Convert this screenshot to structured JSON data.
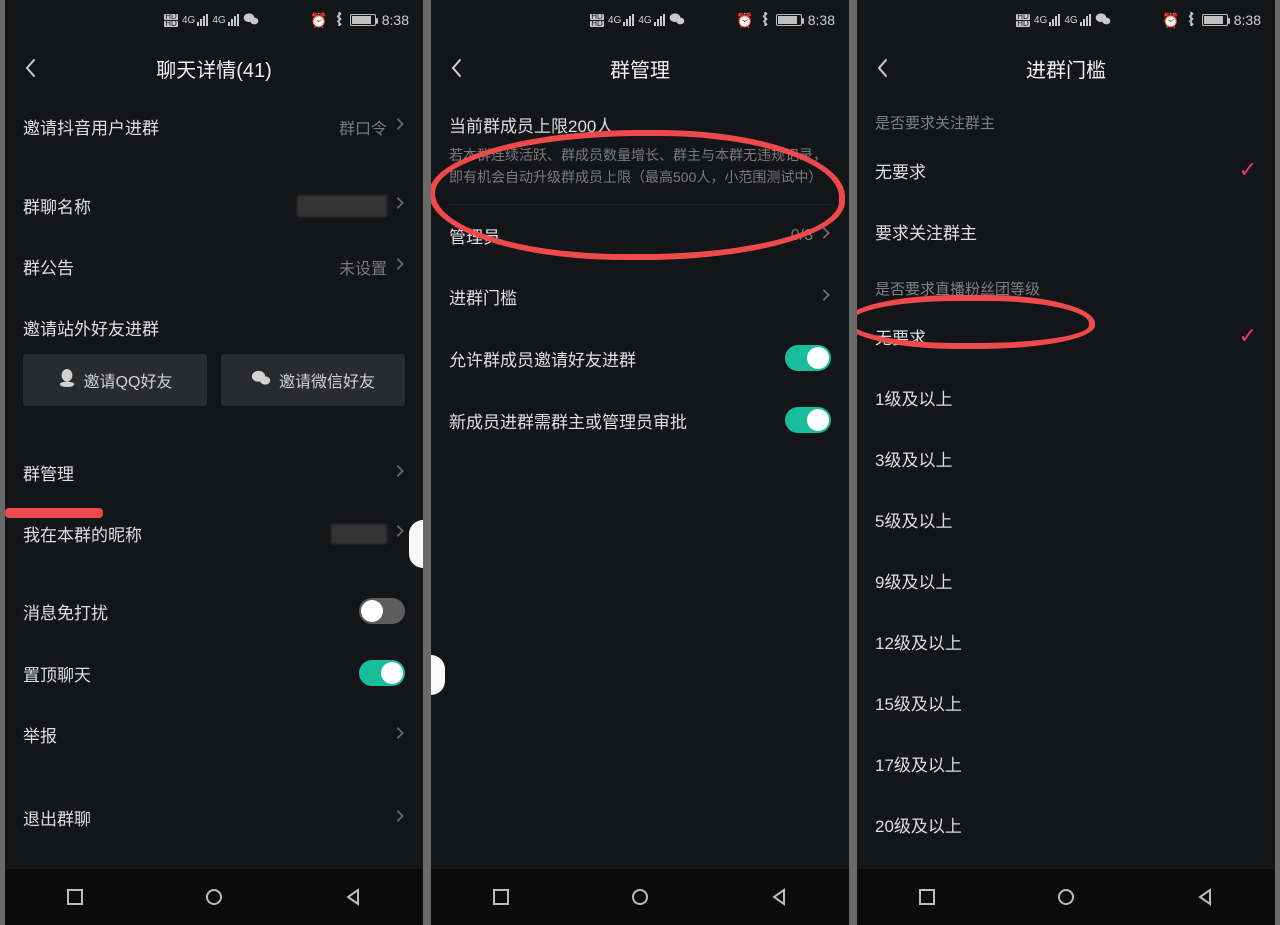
{
  "status": {
    "time": "8:38",
    "hd1": "HD",
    "hd2": "HD",
    "net1": "4G",
    "net2": "4G"
  },
  "screen1": {
    "title": "聊天详情(41)",
    "invite_user": "邀请抖音用户进群",
    "invite_user_val": "群口令",
    "group_name_label": "群聊名称",
    "announcement_label": "群公告",
    "announcement_val": "未设置",
    "invite_ext_header": "邀请站外好友进群",
    "invite_qq": "邀请QQ好友",
    "invite_wechat": "邀请微信好友",
    "group_manage": "群管理",
    "nickname_label": "我在本群的昵称",
    "mute_label": "消息免打扰",
    "pin_label": "置顶聊天",
    "report_label": "举报",
    "leave_label": "退出群聊"
  },
  "screen2": {
    "title": "群管理",
    "limit_title": "当前群成员上限200人",
    "limit_desc": "若本群连续活跃、群成员数量增长、群主与本群无违规记录，即有机会自动升级群成员上限（最高500人，小范围测试中）",
    "admin_label": "管理员",
    "admin_val": "0/3",
    "threshold_label": "进群门槛",
    "allow_invite_label": "允许群成员邀请好友进群",
    "approve_label": "新成员进群需群主或管理员审批"
  },
  "screen3": {
    "title": "进群门槛",
    "section1": "是否要求关注群主",
    "opt_none": "无要求",
    "opt_follow": "要求关注群主",
    "section2": "是否要求直播粉丝团等级",
    "levels": [
      "无要求",
      "1级及以上",
      "3级及以上",
      "5级及以上",
      "9级及以上",
      "12级及以上",
      "15级及以上",
      "17级及以上",
      "20级及以上"
    ]
  }
}
